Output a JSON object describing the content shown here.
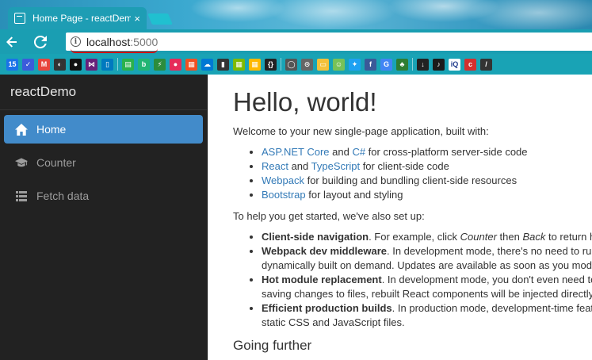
{
  "browser": {
    "tab_title": "Home Page - reactDemo",
    "tab_close": "×",
    "url_host": "localhost",
    "url_port": ":5000",
    "info_icon": "i",
    "bookmarks": [
      {
        "icon": "calendar-icon",
        "color": "#1a73e8",
        "text": "15"
      },
      {
        "icon": "checkmark-mail-icon",
        "color": "#3b5bdb",
        "text": "✓"
      },
      {
        "icon": "gmail-icon",
        "color": "#e8453c",
        "text": "M"
      },
      {
        "icon": "pocket-icon",
        "color": "#333333",
        "text": "◐"
      },
      {
        "icon": "github-icon",
        "color": "#111111",
        "text": "●"
      },
      {
        "icon": "visual-studio-icon",
        "color": "#68217a",
        "text": "⋈"
      },
      {
        "icon": "trello-icon",
        "color": "#0079bf",
        "text": "▯"
      },
      {
        "icon": "feedly-icon",
        "color": "#2bb24c",
        "text": "▤"
      },
      {
        "icon": "bitly-icon",
        "color": "#22b573",
        "text": "b"
      },
      {
        "icon": "feather-icon",
        "color": "#2c8c3c",
        "text": "⚡"
      },
      {
        "icon": "youtube-music-icon",
        "color": "#e62b5a",
        "text": "●"
      },
      {
        "icon": "windows-icon",
        "color": "#f25022",
        "text": "▦"
      },
      {
        "icon": "cloud-icon",
        "color": "#0078d4",
        "text": "☁"
      },
      {
        "icon": "stats-icon",
        "color": "#333333",
        "text": "▮"
      },
      {
        "icon": "microsoft-icon",
        "color": "#7fba00",
        "text": "▦"
      },
      {
        "icon": "office-icon",
        "color": "#ffb900",
        "text": "▦"
      },
      {
        "icon": "json-icon",
        "color": "#222222",
        "text": "{}"
      },
      {
        "icon": "browser-icon",
        "color": "#555555",
        "text": "◯"
      },
      {
        "icon": "search-icon",
        "color": "#666666",
        "text": "⊙"
      },
      {
        "icon": "notes-icon",
        "color": "#f3c13a",
        "text": "▭"
      },
      {
        "icon": "android-icon",
        "color": "#78c257",
        "text": "☺"
      },
      {
        "icon": "twitter-icon",
        "color": "#1da1f2",
        "text": "✦"
      },
      {
        "icon": "facebook-icon",
        "color": "#3b5998",
        "text": "f"
      },
      {
        "icon": "translate-icon",
        "color": "#4285f4",
        "text": "G"
      },
      {
        "icon": "tree-icon",
        "color": "#2e7d32",
        "text": "♣"
      },
      {
        "icon": "download-icon",
        "color": "#222222",
        "text": "↓"
      },
      {
        "icon": "chart-icon",
        "color": "#1b1b1b",
        "text": "♪"
      },
      {
        "icon": "infoq-icon",
        "color": "#ffffff",
        "text": "iQ"
      },
      {
        "icon": "c-icon",
        "color": "#d32f2f",
        "text": "c"
      },
      {
        "icon": "bolt-icon",
        "color": "#333333",
        "text": "/"
      }
    ]
  },
  "sidebar": {
    "brand": "reactDemo",
    "items": [
      {
        "label": "Home",
        "icon": "home-icon",
        "active": true
      },
      {
        "label": "Counter",
        "icon": "graduation-cap-icon",
        "active": false
      },
      {
        "label": "Fetch data",
        "icon": "list-icon",
        "active": false
      }
    ]
  },
  "main": {
    "title": "Hello, world!",
    "intro": "Welcome to your new single-page application, built with:",
    "built_with": [
      {
        "link1": "ASP.NET Core",
        "mid": " and ",
        "link2": "C#",
        "rest": " for cross-platform server-side code"
      },
      {
        "link1": "React",
        "mid": " and ",
        "link2": "TypeScript",
        "rest": " for client-side code"
      },
      {
        "link1": "Webpack",
        "mid": "",
        "link2": "",
        "rest": " for building and bundling client-side resources"
      },
      {
        "link1": "Bootstrap",
        "mid": "",
        "link2": "",
        "rest": " for layout and styling"
      }
    ],
    "setup_intro": "To help you get started, we've also set up:",
    "features": [
      {
        "bold": "Client-side navigation",
        "text1": ". For example, click ",
        "italic1": "Counter",
        "text2": " then ",
        "italic2": "Back",
        "text3": " to return here."
      },
      {
        "bold": "Webpack dev middleware",
        "text1": ". In development mode, there's no need to run the ",
        "italic1": "",
        "text2": "",
        "italic2": "",
        "text3": "dynamically built on demand. Updates are available as soon as you modify a file."
      },
      {
        "bold": "Hot module replacement",
        "text1": ". In development mode, you don't even need to reload the page ",
        "italic1": "",
        "text2": "",
        "italic2": "",
        "text3": "saving changes to files, rebuilt React components will be injected directly into"
      },
      {
        "bold": "Efficient production builds",
        "text1": ". In production mode, development-time features are ",
        "italic1": "",
        "text2": "",
        "italic2": "",
        "text3": "static CSS and JavaScript files."
      }
    ],
    "going_further": "Going further"
  }
}
